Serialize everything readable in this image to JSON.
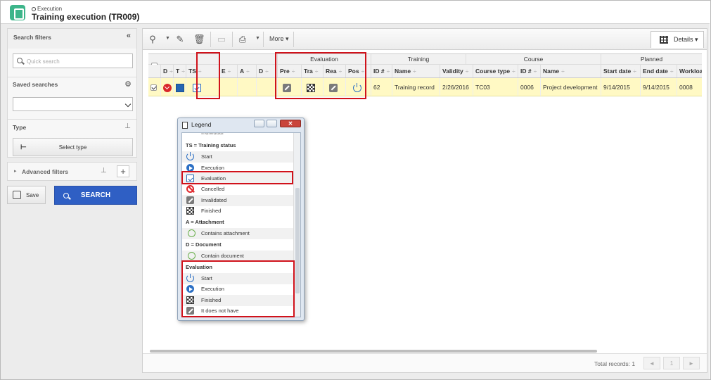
{
  "header": {
    "breadcrumb": "Execution",
    "title": "Training execution (TR009)"
  },
  "sidebar": {
    "search_filters": "Search filters",
    "quick_search_placeholder": "Quick search",
    "saved_searches": "Saved searches",
    "saved_search_value": "",
    "type_label": "Type",
    "select_type": "Select type",
    "advanced_filters": "Advanced filters",
    "save": "Save",
    "search": "SEARCH"
  },
  "toolbar": {
    "more": "More",
    "details": "Details"
  },
  "table": {
    "groups": {
      "evaluation": "Evaluation",
      "training": "Training",
      "course": "Course",
      "planned": "Planned"
    },
    "columns": {
      "d": "D",
      "t": "T",
      "ts": "TS",
      "e": "E",
      "a": "A",
      "d2": "D",
      "pre": "Pre",
      "tra": "Tra",
      "rea": "Rea",
      "pos": "Pos",
      "id": "ID #",
      "name": "Name",
      "validity": "Validity",
      "course_type": "Course type",
      "course_id": "ID #",
      "course_name": "Name",
      "start_date": "Start date",
      "end_date": "End date",
      "workload": "Workload"
    },
    "row": {
      "id": "62",
      "name": "Training record",
      "validity": "2/26/2016",
      "course_type": "TC03",
      "course_id": "0006",
      "course_name": "Project development",
      "start_date": "9/14/2015",
      "end_date": "9/14/2015",
      "workload": "0008"
    }
  },
  "footer": {
    "total": "Total records: 1",
    "page": "1"
  },
  "legend": {
    "title": "Legend",
    "partial": "Individual",
    "ts_header": "TS = Training status",
    "ts_items": [
      "Start",
      "Execution",
      "Evaluation",
      "Cancelled",
      "Invalidated",
      "Finished"
    ],
    "a_header": "A = Attachment",
    "a_item": "Contains attachment",
    "d_header": "D = Document",
    "d_item": "Contain document",
    "eval_header": "Evaluation",
    "eval_items": [
      "Start",
      "Execution",
      "Finished",
      "It does not have"
    ]
  },
  "colors": {
    "search_button": "#2f5fc4",
    "highlight": "#d0121b",
    "row_selected": "#fff9c4"
  }
}
